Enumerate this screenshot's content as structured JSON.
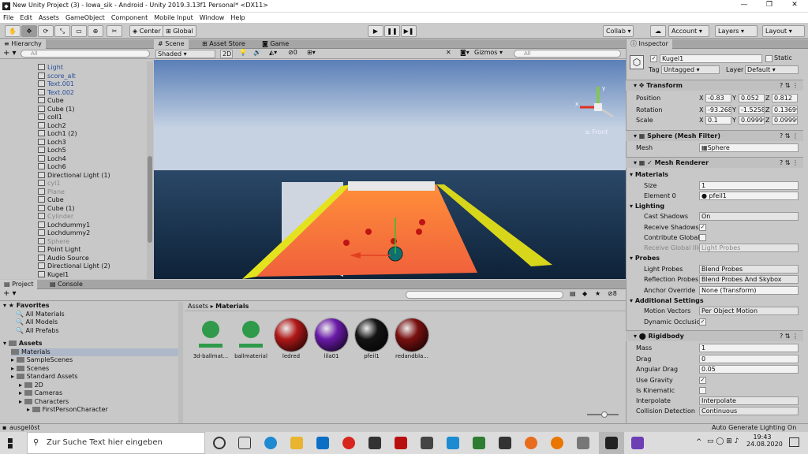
{
  "window": {
    "title": "New Unity Project (3) - Iowa_sik - Android - Unity 2019.3.13f1 Personal* <DX11>"
  },
  "menu": [
    "File",
    "Edit",
    "Assets",
    "GameObject",
    "Component",
    "Mobile Input",
    "Window",
    "Help"
  ],
  "toolbar": {
    "center": "Center",
    "global": "Global",
    "collab": "Collab ▾",
    "account": "Account",
    "layers": "Layers",
    "layout": "Layout"
  },
  "hierarchy": {
    "tab": "Hierarchy",
    "search": "All",
    "items": [
      {
        "label": "Light",
        "style": "blue"
      },
      {
        "label": "score_alt",
        "style": "blue"
      },
      {
        "label": "Text.001",
        "style": "blue"
      },
      {
        "label": "Text.002",
        "style": "blue"
      },
      {
        "label": "Cube",
        "style": ""
      },
      {
        "label": "Cube (1)",
        "style": ""
      },
      {
        "label": "coll1",
        "style": ""
      },
      {
        "label": "Loch2",
        "style": ""
      },
      {
        "label": "Loch1 (2)",
        "style": ""
      },
      {
        "label": "Loch3",
        "style": ""
      },
      {
        "label": "Loch5",
        "style": ""
      },
      {
        "label": "Loch4",
        "style": ""
      },
      {
        "label": "Loch6",
        "style": ""
      },
      {
        "label": "Directional Light (1)",
        "style": ""
      },
      {
        "label": "cyl1",
        "style": "gray"
      },
      {
        "label": "Plane",
        "style": "gray"
      },
      {
        "label": "Cube",
        "style": ""
      },
      {
        "label": "Cube (1)",
        "style": ""
      },
      {
        "label": "Cylinder",
        "style": "gray"
      },
      {
        "label": "Lochdummy1",
        "style": ""
      },
      {
        "label": "Lochdummy2",
        "style": ""
      },
      {
        "label": "Sphere",
        "style": "gray"
      },
      {
        "label": "Point Light",
        "style": ""
      },
      {
        "label": "Audio Source",
        "style": ""
      },
      {
        "label": "Directional Light (2)",
        "style": ""
      },
      {
        "label": "Kugel1",
        "style": ""
      }
    ]
  },
  "scene": {
    "tabs": [
      "Scene",
      "Asset Store",
      "Game"
    ],
    "shading": "Shaded",
    "mode2d": "2D",
    "count": "0",
    "gizmos": "Gizmos",
    "search": "All",
    "front": "Front"
  },
  "project": {
    "tabs": [
      "Project",
      "Console"
    ],
    "favorites": {
      "title": "Favorites",
      "items": [
        "All Materials",
        "All Models",
        "All Prefabs"
      ]
    },
    "assets_title": "Assets",
    "tree": [
      {
        "label": "Materials",
        "indent": 1,
        "sel": true
      },
      {
        "label": "SampleScenes",
        "indent": 1
      },
      {
        "label": "Scenes",
        "indent": 1
      },
      {
        "label": "Standard Assets",
        "indent": 1
      },
      {
        "label": "2D",
        "indent": 2
      },
      {
        "label": "Cameras",
        "indent": 2
      },
      {
        "label": "Characters",
        "indent": 2
      },
      {
        "label": "FirstPersonCharacter",
        "indent": 3
      }
    ],
    "breadcrumb": [
      "Assets",
      "Materials"
    ],
    "layercount": "8",
    "materials": [
      {
        "label": "3d-ballmat...",
        "kind": "icon"
      },
      {
        "label": "ballmaterial",
        "kind": "icon"
      },
      {
        "label": "ledred",
        "kind": "sphere",
        "color": "#b01818"
      },
      {
        "label": "lila01",
        "kind": "sphere",
        "color": "#6a1aa8"
      },
      {
        "label": "pfeil1",
        "kind": "sphere",
        "color": "#141414"
      },
      {
        "label": "redandbla...",
        "kind": "sphere",
        "color": "#7a1010"
      }
    ]
  },
  "status": {
    "left": "ausgelöst",
    "right": "Auto Generate Lighting On"
  },
  "inspector": {
    "tab": "Inspector",
    "name": "Kugel1",
    "static": "Static",
    "tag": "Untagged",
    "layer": "Default",
    "transform": {
      "title": "Transform",
      "position": [
        "-0.83",
        "0.052",
        "0.812"
      ],
      "rotation": [
        "-93.268",
        "-1.5258",
        "0.13699"
      ],
      "scale": [
        "0.1",
        "0.09999",
        "0.09999"
      ]
    },
    "meshfilter": {
      "title": "Sphere (Mesh Filter)",
      "mesh_label": "Mesh",
      "mesh": "Sphere"
    },
    "meshrenderer": {
      "title": "Mesh Renderer",
      "materials": "Materials",
      "size_label": "Size",
      "size": "1",
      "element_label": "Element 0",
      "element": "pfeil1",
      "lighting": "Lighting",
      "cast_label": "Cast Shadows",
      "cast": "On",
      "receive_label": "Receive Shadows",
      "contrib_label": "Contribute Global",
      "recvgi_label": "Receive Global Illu",
      "recvgi": "Light Probes",
      "probes": "Probes",
      "lightprobes_label": "Light Probes",
      "lightprobes": "Blend Probes",
      "refl_label": "Reflection Probes",
      "refl": "Blend Probes And Skybox",
      "anchor_label": "Anchor Override",
      "anchor": "None (Transform)",
      "additional": "Additional Settings",
      "motion_label": "Motion Vectors",
      "motion": "Per Object Motion",
      "dyn_label": "Dynamic Occlusio"
    },
    "rigidbody": {
      "title": "Rigidbody",
      "mass_label": "Mass",
      "mass": "1",
      "drag_label": "Drag",
      "drag": "0",
      "adrag_label": "Angular Drag",
      "adrag": "0.05",
      "grav_label": "Use Gravity",
      "kin_label": "Is Kinematic",
      "interp_label": "Interpolate",
      "interp": "Interpolate",
      "coll_label": "Collision Detection",
      "coll": "Continuous"
    }
  },
  "taskbar": {
    "search": "Zur Suche Text hier eingeben",
    "time": "19:43",
    "date": "24.08.2020"
  }
}
